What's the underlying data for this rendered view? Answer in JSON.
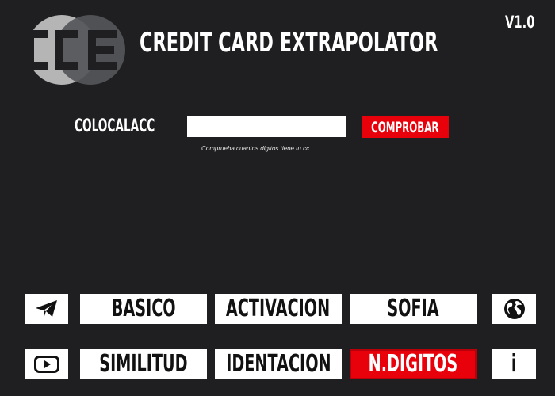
{
  "header": {
    "logo_text": "CCE",
    "title": "CREDIT CARD EXTRAPOLATOR",
    "version": "V1.0"
  },
  "form": {
    "label": "COLOCALACC",
    "input_value": "",
    "input_placeholder": "",
    "check_label": "COMPROBAR",
    "hint": "Comprueba cuantos digitos tiene tu cc"
  },
  "menu": {
    "row1": {
      "icon_left": "telegram-icon",
      "buttons": [
        "BASICO",
        "ACTIVACION",
        "SOFIA"
      ],
      "icon_right": "globe-icon"
    },
    "row2": {
      "icon_left": "youtube-icon",
      "buttons": [
        "SIMILITUD",
        "IDENTACION",
        "N.DIGITOS"
      ],
      "icon_right": "info-icon",
      "info_label": "i"
    },
    "active_button": "N.DIGITOS"
  },
  "colors": {
    "background": "#1f1f21",
    "accent": "#e8000b",
    "tile": "#ffffff",
    "logo_circle_left": "#b5b5b5",
    "logo_circle_right": "#55565a"
  }
}
